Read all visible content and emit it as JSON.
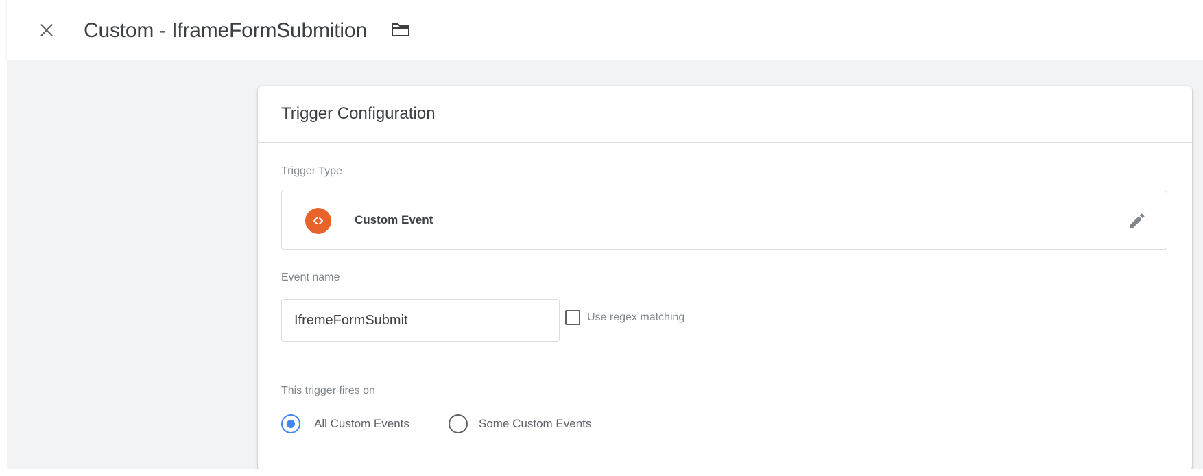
{
  "header": {
    "title": "Custom - IframeFormSubmition",
    "close_icon": "close-icon",
    "folder_icon": "folder-icon"
  },
  "card": {
    "title": "Trigger Configuration",
    "trigger_type": {
      "label": "Trigger Type",
      "name": "Custom Event",
      "icon": "custom-event-icon",
      "icon_color": "#e8622c",
      "edit_icon": "pencil-icon"
    },
    "event_name": {
      "label": "Event name",
      "value": "IfremeFormSubmit"
    },
    "regex": {
      "label": "Use regex matching",
      "checked": false
    },
    "fires_on": {
      "label": "This trigger fires on",
      "options": [
        {
          "label": "All Custom Events",
          "selected": true
        },
        {
          "label": "Some Custom Events",
          "selected": false
        }
      ]
    }
  },
  "colors": {
    "accent": "#4285f4",
    "canvas_bg": "#f1f3f4"
  }
}
